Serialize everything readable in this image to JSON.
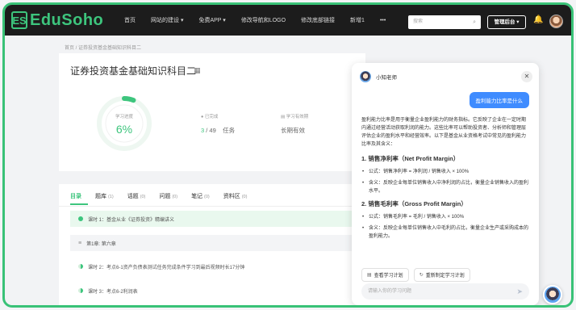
{
  "header": {
    "logo_mark": "ES",
    "logo_text": "EduSoho",
    "nav": [
      "首页",
      "网站的建设 ▾",
      "免费APP ▾",
      "修改导航和LOGO",
      "修改底部链接",
      "新增1",
      "•••"
    ],
    "search_placeholder": "搜索",
    "admin_label": "管理后台 ▾"
  },
  "breadcrumb": "首页 / 证券投资基金基础知识科目二",
  "course": {
    "title": "证券投资基金基础知识科目二",
    "progress_label": "学习进度",
    "progress_value": "6%",
    "progress_fraction": 0.06,
    "completed_label": "已完成",
    "completed_done": "3",
    "completed_total": "/ 49",
    "completed_unit": "任务",
    "validity_label": "学习有效期",
    "validity_value": "长期有效"
  },
  "tabs": [
    {
      "label": "目录",
      "count": ""
    },
    {
      "label": "题库",
      "count": "(1)"
    },
    {
      "label": "话题",
      "count": "(0)"
    },
    {
      "label": "问题",
      "count": "(0)"
    },
    {
      "label": "笔记",
      "count": "(0)"
    },
    {
      "label": "资料区",
      "count": "(0)"
    }
  ],
  "lessons": [
    {
      "text": "课时 1：基金从业《证券投资》精编讲义",
      "state": "done"
    },
    {
      "text": "第1章: 第六章",
      "state": "chapter"
    },
    {
      "text": "课时 2：考点6-1资产负债表测试任务完成条件学习到最后视频时长17分钟",
      "state": "half"
    },
    {
      "text": "课时 3：考点6-2利润表",
      "state": "empty"
    }
  ],
  "ai": {
    "name": "小知老师",
    "user_question": "盈利能力比率是什么",
    "intro": "盈利能力比率是用于衡量企业盈利能力的财务指标。它反映了企业在一定时期内通过经营活动获取利润的能力。这些比率可以帮助投资者、分析师和管理层评估企业的盈利水平和经营效率。以下是基金从业资格考试中常见的盈利能力比率及其含义：",
    "sections": [
      {
        "heading": "1. 销售净利率（Net Profit Margin）",
        "formula": "公式：销售净利率 = 净利润 / 销售收入 × 100%",
        "meaning": "含义：反映企业每单位销售收入中净利润的占比，衡量企业销售收入的盈利水平。"
      },
      {
        "heading": "2. 销售毛利率（Gross Profit Margin）",
        "formula": "公式：销售毛利率 = 毛利 / 销售收入 × 100%",
        "meaning": "含义：反映企业每单位销售收入中毛利的占比，衡量企业生产或采购成本的盈利能力。"
      }
    ],
    "action_view_plan": "查看学习计划",
    "action_replan": "重新制定学习计划",
    "input_placeholder": "请输入你的学习问题"
  }
}
